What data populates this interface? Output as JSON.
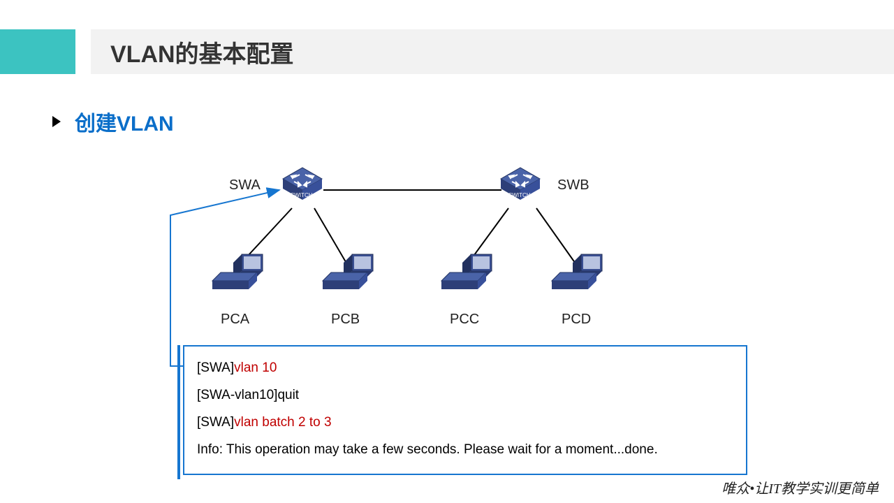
{
  "title": "VLAN的基本配置",
  "subheading": "创建VLAN",
  "labels": {
    "swa": "SWA",
    "swb": "SWB",
    "pca": "PCA",
    "pcb": "PCB",
    "pcc": "PCC",
    "pcd": "PCD"
  },
  "cli": {
    "line1_prefix": "[SWA]",
    "line1_cmd": "vlan 10",
    "line2": "[SWA-vlan10]quit",
    "line3_prefix": "[SWA]",
    "line3_cmd": "vlan batch 2 to 3",
    "line4": "Info: This operation may take a few seconds. Please wait for a moment...done."
  },
  "footer": "唯众•让IT教学实训更简单",
  "icons": {
    "switch_text": "SWITCH"
  }
}
